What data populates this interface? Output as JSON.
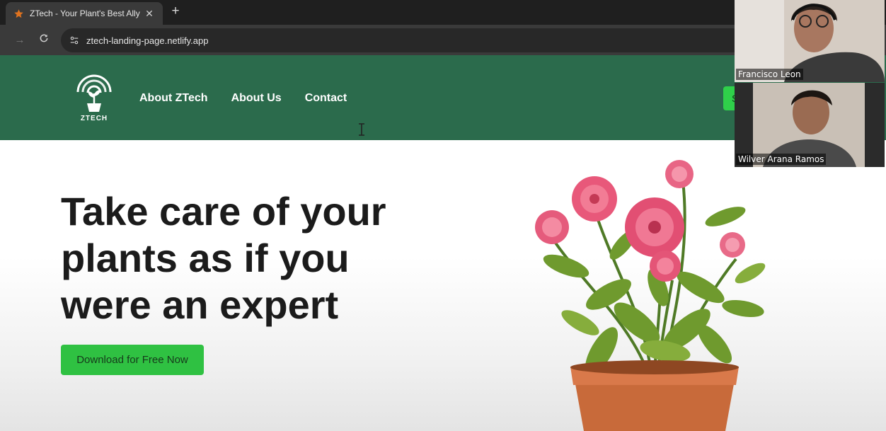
{
  "browser": {
    "tab_title": "ZTech - Your Plant's Best Ally",
    "tab_favicon_icon": "star-icon",
    "url": "ztech-landing-page.netlify.app",
    "new_tab_label": "+",
    "close_tab_label": "✕"
  },
  "site": {
    "logo_text": "ZTECH",
    "nav": [
      {
        "label": "About ZTech"
      },
      {
        "label": "About Us"
      },
      {
        "label": "Contact"
      }
    ],
    "signup_label": "S"
  },
  "hero": {
    "title_lines": [
      "Take care of your",
      "plants as if you",
      "were an expert"
    ],
    "cta_label": "Download for Free Now"
  },
  "call": {
    "participants": [
      {
        "name": "Francisco Leon"
      },
      {
        "name": "Wilver Arana Ramos"
      }
    ]
  },
  "colors": {
    "header_green": "#2b6b4c",
    "cta_green": "#2fc142",
    "hero_text": "#1b1b1b"
  }
}
